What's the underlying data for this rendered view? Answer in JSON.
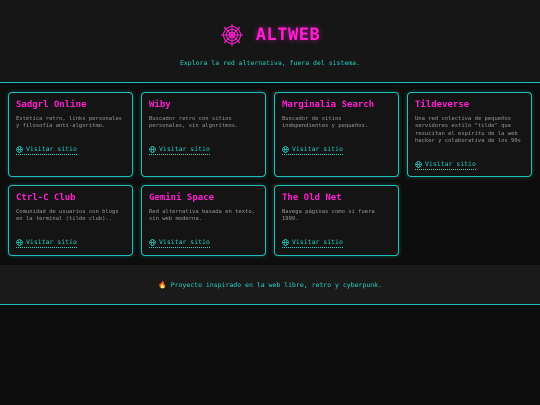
{
  "header": {
    "title": "ALTWEB",
    "icon": "spider-web-icon",
    "tagline": "Explora la red alternativa, fuera del sistema."
  },
  "colors": {
    "accent_pink": "#ff1fd2",
    "accent_cyan": "#28d3c8",
    "background": "#0d0d0d"
  },
  "cards": [
    {
      "title": "Sadgrl Online",
      "description": "Estética retro, links personales y filosofía anti-algoritmo.",
      "link": "Visitar sitio"
    },
    {
      "title": "Wiby",
      "description": "Buscador retro con sitios personales, sin algoritmos.",
      "link": "Visitar sitio"
    },
    {
      "title": "Marginalia Search",
      "description": "Buscador de sitios independientes y pequeños.",
      "link": "Visitar sitio"
    },
    {
      "title": "Tildeverse",
      "description": "Una red colectiva de pequeños servidores estilo \"tilde\" que resucitan el espíritu de la web hacker y colaborativa de los 90s",
      "link": "Visitar sitio"
    },
    {
      "title": "Ctrl-C Club",
      "description": "Comunidad de usuarios con blogs en la terminal (tilde club)..",
      "link": "Visitar sitio"
    },
    {
      "title": "Gemini Space",
      "description": "Red alternativa basada en texto, sin web moderna.",
      "link": "Visitar sitio"
    },
    {
      "title": "The Old Net",
      "description": "Navega páginas como si fuera 1999.",
      "link": "Visitar sitio"
    }
  ],
  "footer": {
    "icon": "fire-icon",
    "text": "Proyecto inspirado en la web libre, retro y cyberpunk."
  }
}
